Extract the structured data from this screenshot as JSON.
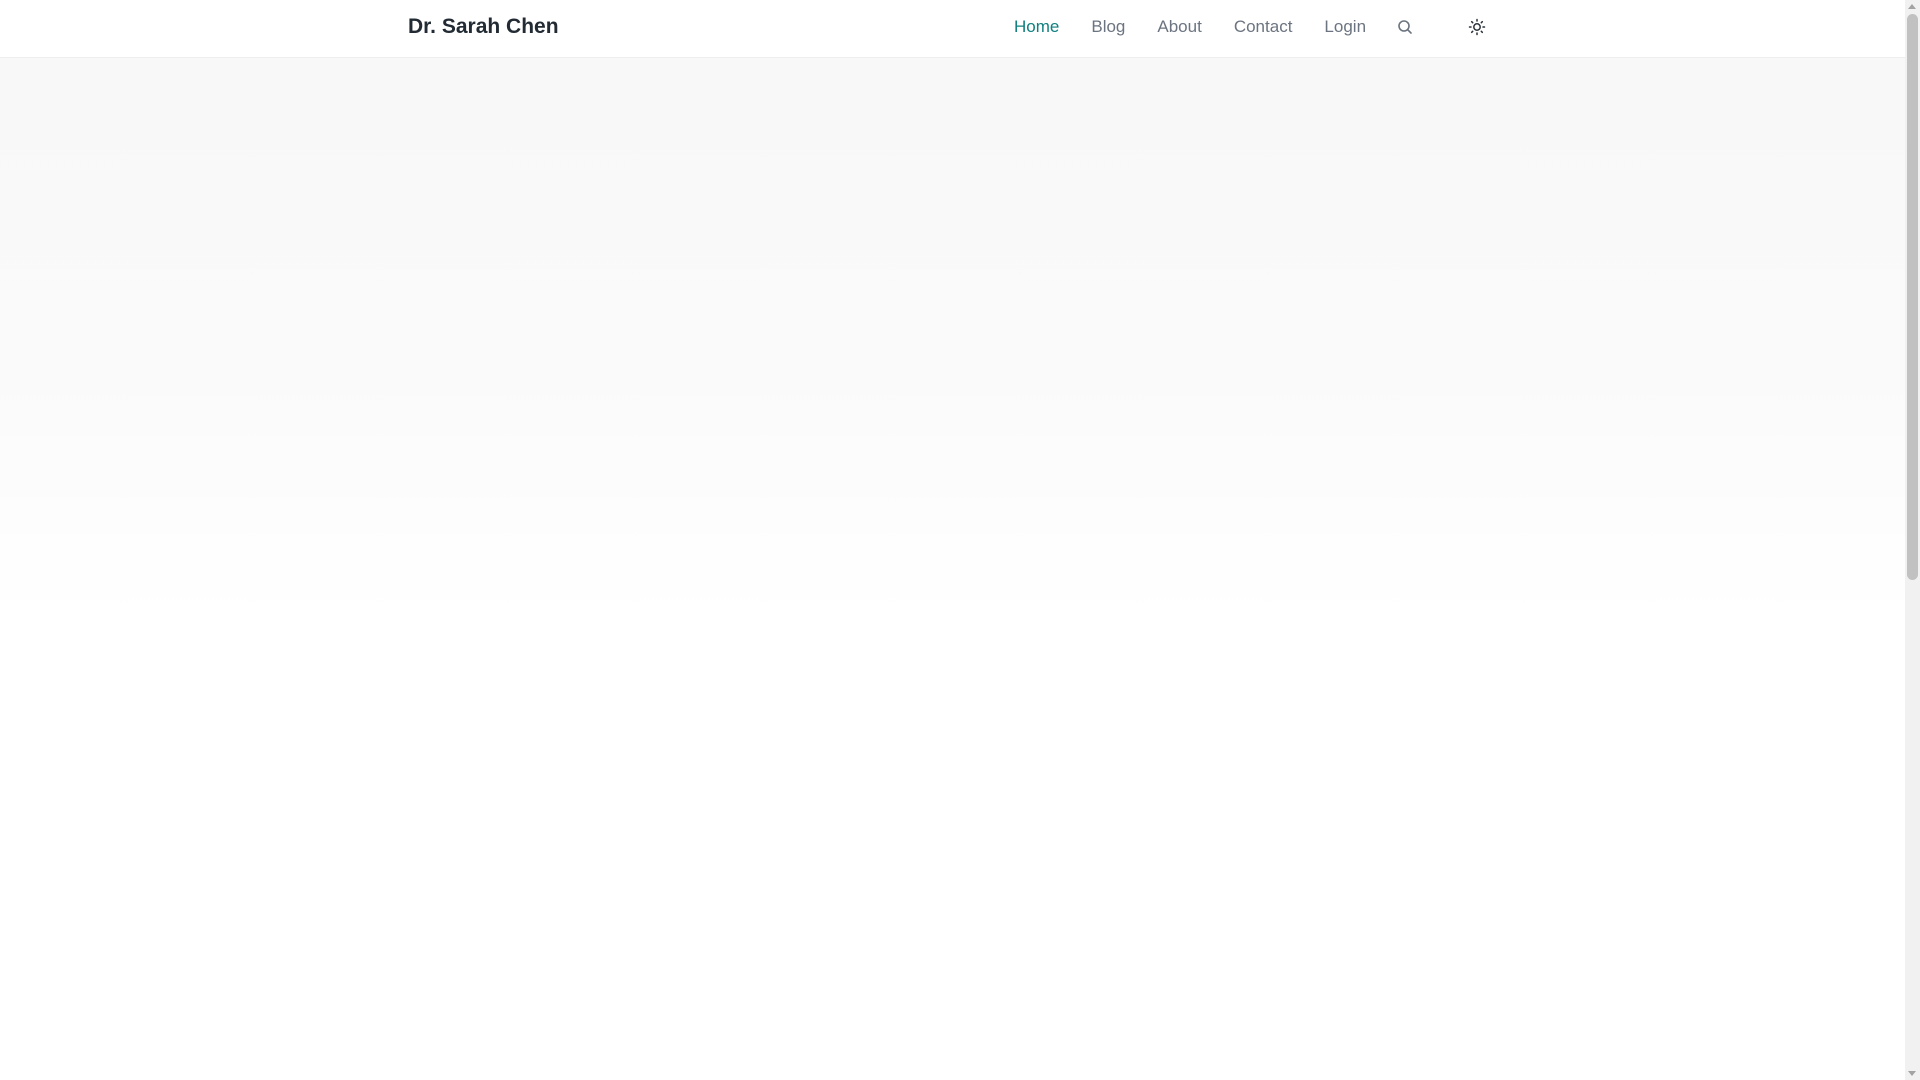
{
  "header": {
    "brand": "Dr. Sarah Chen",
    "nav": [
      {
        "label": "Home",
        "active": true
      },
      {
        "label": "Blog",
        "active": false
      },
      {
        "label": "About",
        "active": false
      },
      {
        "label": "Contact",
        "active": false
      },
      {
        "label": "Login",
        "active": false
      }
    ],
    "icons": {
      "search": "search-icon",
      "theme": "sun-icon"
    }
  },
  "colors": {
    "accent": "#0f7f7f",
    "nav_text": "#6b7480",
    "brand_text": "#222b33",
    "hero_bg": "#f8f8f8"
  }
}
